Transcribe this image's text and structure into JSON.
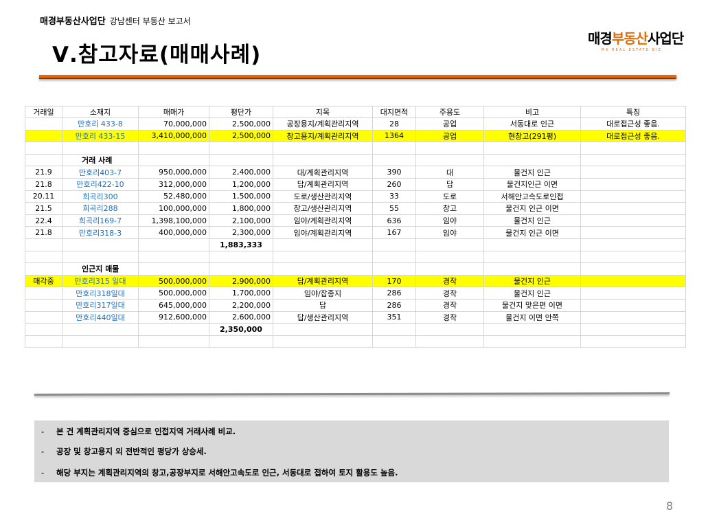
{
  "header": {
    "org": "매경부동산사업단",
    "center": "강남센터 부동산 보고서",
    "heading": "Ⅴ.참고자료(매매사례)",
    "logo_a": "매경",
    "logo_b": "부동산",
    "logo_c": "사업단",
    "logo_tag": "MK REAL ESTATE BIZ"
  },
  "table": {
    "columns": [
      "거래일",
      "소재지",
      "매매가",
      "평단가",
      "지목",
      "대지면적",
      "주용도",
      "비고",
      "특징"
    ],
    "subject": [
      {
        "date": "",
        "loc": "만호리 433-8",
        "price": "70,000,000",
        "unit": "2,500,000",
        "jimok": "공장용지/계획관리지역",
        "area": "28",
        "use": "공업",
        "note": "서동대로 인근",
        "feat": "대로접근성 좋음."
      },
      {
        "date": "",
        "loc": "만호리 433-15",
        "price": "3,410,000,000",
        "unit": "2,500,000",
        "jimok": "창고용지/계획관리지역",
        "area": "1364",
        "use": "공업",
        "note": "현창고(291평)",
        "feat": "대로접근성 좋음."
      }
    ],
    "section_trade": "거래 사례",
    "trades": [
      {
        "date": "21.9",
        "loc": "만호리403-7",
        "price": "950,000,000",
        "unit": "2,400,000",
        "jimok": "대/계획관리지역",
        "area": "390",
        "use": "대",
        "note": "물건지 인근"
      },
      {
        "date": "21.8",
        "loc": "만호리422-10",
        "price": "312,000,000",
        "unit": "1,200,000",
        "jimok": "답/계획관리지역",
        "area": "260",
        "use": "답",
        "note": "물건지인근 이면"
      },
      {
        "date": "20.11",
        "loc": "희곡리300",
        "price": "52,480,000",
        "unit": "1,500,000",
        "jimok": "도로/생산관리지역",
        "area": "33",
        "use": "도로",
        "note": "서해안고속도로인접"
      },
      {
        "date": "21.5",
        "loc": "희곡리288",
        "price": "100,000,000",
        "unit": "1,800,000",
        "jimok": "창고/생산관리지역",
        "area": "55",
        "use": "창고",
        "note": "물건지 인근 이면"
      },
      {
        "date": "22.4",
        "loc": "희곡리169-7",
        "price": "1,398,100,000",
        "unit": "2,100,000",
        "jimok": "임야/계획관리지역",
        "area": "636",
        "use": "임야",
        "note": "물건지 인근"
      },
      {
        "date": "21.8",
        "loc": "만호리318-3",
        "price": "400,000,000",
        "unit": "2,300,000",
        "jimok": "임야/계획관리지역",
        "area": "167",
        "use": "임야",
        "note": "물건지 인근 이면"
      }
    ],
    "trade_avg": "1,883,333",
    "section_nearby": "인근지 매물",
    "nearby": [
      {
        "date": "매각중",
        "loc": "만호리315 일대",
        "price": "500,000,000",
        "unit": "2,900,000",
        "jimok": "답/계획관리지역",
        "area": "170",
        "use": "경작",
        "note": "물건지 인근"
      },
      {
        "date": "",
        "loc": "만호리318일대",
        "price": "500,000,000",
        "unit": "1,700,000",
        "jimok": "임야/잡종지",
        "area": "286",
        "use": "경작",
        "note": "물건지 인근"
      },
      {
        "date": "",
        "loc": "만호리317일대",
        "price": "645,000,000",
        "unit": "2,200,000",
        "jimok": "답",
        "area": "286",
        "use": "경작",
        "note": "물건지 맞은편 이면"
      },
      {
        "date": "",
        "loc": "만호리440일대",
        "price": "912,600,000",
        "unit": "2,600,000",
        "jimok": "답/생산관리지역",
        "area": "351",
        "use": "경작",
        "note": "물건지 이면 안쪽"
      }
    ],
    "nearby_avg": "2,350,000"
  },
  "notes": {
    "dash": "-",
    "n1": "본 건 계획관리지역 중심으로 인접지역 거래사례 비교.",
    "n2": "공장 및 창고용지 외 전반적인 평당가 상승세.",
    "n3": "해당 부지는 계획관리지역의 창고,공장부지로 서해안고속도로 인근, 서동대로 접하여  토지 활용도 높음."
  },
  "page_number": "8",
  "colors": {
    "accent": "#e36c09",
    "highlight": "#ffff00",
    "link": "#1f6fc3",
    "notes_bg": "#d9d9d9"
  }
}
